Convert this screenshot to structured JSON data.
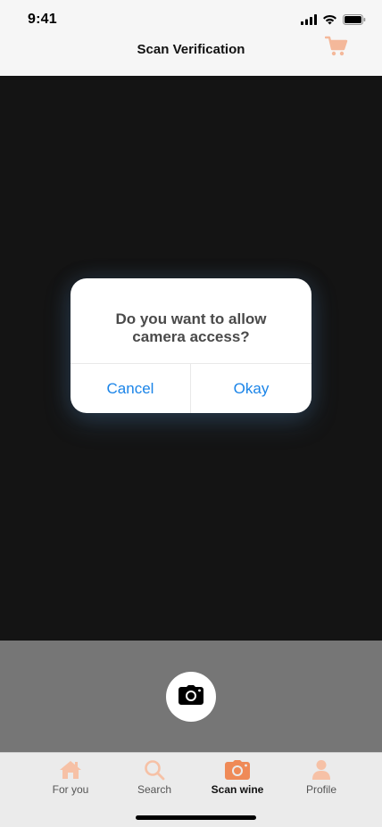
{
  "status_bar": {
    "time": "9:41"
  },
  "nav": {
    "title": "Scan Verification"
  },
  "dialog": {
    "message": "Do you want to allow camera access?",
    "cancel_label": "Cancel",
    "okay_label": "Okay"
  },
  "tabs": [
    {
      "label": "For you",
      "icon": "home-icon",
      "active": false
    },
    {
      "label": "Search",
      "icon": "search-icon",
      "active": false
    },
    {
      "label": "Scan wine",
      "icon": "camera-icon",
      "active": true
    },
    {
      "label": "Profile",
      "icon": "profile-icon",
      "active": false
    }
  ],
  "colors": {
    "accent": "#f4a27a",
    "accent_active": "#ef8a57",
    "link_blue": "#1a84e8",
    "camera_bg": "#141414"
  }
}
